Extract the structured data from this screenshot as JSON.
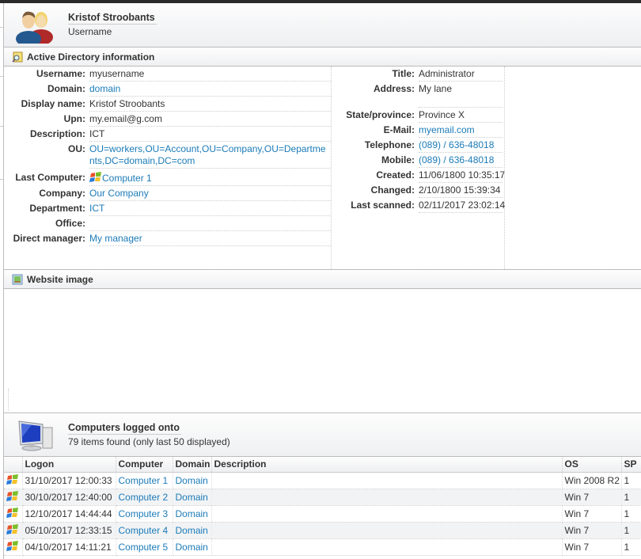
{
  "user": {
    "name": "Kristof Stroobants",
    "subtitle": "Username"
  },
  "sections": {
    "ad": {
      "title": "Active Directory information",
      "icon": "search-document-icon"
    },
    "website": {
      "title": "Website image",
      "icon": "image-icon"
    },
    "computers": {
      "title": "Computers logged onto",
      "subtitle": "79 items found (only last 50 displayed)",
      "icon": "computer-icon"
    }
  },
  "ad_left": [
    {
      "label": "Username:",
      "value": "myusername",
      "link": false
    },
    {
      "label": "Domain:",
      "value": "domain",
      "link": true
    },
    {
      "label": "Display name:",
      "value": "Kristof Stroobants",
      "link": false
    },
    {
      "label": "Upn:",
      "value": "my.email@g.com",
      "link": false
    },
    {
      "label": "Description:",
      "value": "ICT",
      "link": false
    },
    {
      "label": "OU:",
      "value": "OU=workers,OU=Account,OU=Company,OU=Departments,DC=domain,DC=com",
      "link": true
    },
    {
      "label": "Last Computer:",
      "value": "Computer 1",
      "link": true,
      "icon": "windows-icon"
    },
    {
      "label": "Company:",
      "value": "Our Company",
      "link": true
    },
    {
      "label": "Department:",
      "value": "ICT",
      "link": true
    },
    {
      "label": "Office:",
      "value": "",
      "link": false
    },
    {
      "label": "Direct manager:",
      "value": "My manager",
      "link": true
    }
  ],
  "ad_right": [
    {
      "label": "Title:",
      "value": "Administrator",
      "link": false
    },
    {
      "label": "Address:",
      "value": "My lane",
      "link": false,
      "tall": true
    },
    {
      "label": "State/province:",
      "value": "Province X",
      "link": false
    },
    {
      "label": "E-Mail:",
      "value": "myemail.com",
      "link": true
    },
    {
      "label": "Telephone:",
      "value": "(089) / 636-48018",
      "link": true
    },
    {
      "label": "Mobile:",
      "value": "(089) / 636-48018",
      "link": true
    },
    {
      "label": "Created:",
      "value": "11/06/1800 10:35:17",
      "link": false
    },
    {
      "label": "Changed:",
      "value": "2/10/1800 15:39:34",
      "link": false
    },
    {
      "label": "Last scanned:",
      "value": "02/11/2017 23:02:14",
      "link": false
    }
  ],
  "computers_table": {
    "columns": [
      "",
      "Logon",
      "Computer",
      "Domain",
      "Description",
      "OS",
      "SP"
    ],
    "rows": [
      {
        "logon": "31/10/2017 12:00:33",
        "computer": "Computer 1",
        "domain": "Domain",
        "description": "",
        "os": "Win 2008 R2",
        "sp": "1"
      },
      {
        "logon": "30/10/2017 12:40:00",
        "computer": "Computer 2",
        "domain": "Domain",
        "description": "",
        "os": "Win 7",
        "sp": "1"
      },
      {
        "logon": "12/10/2017 14:44:44",
        "computer": "Computer 3",
        "domain": "Domain",
        "description": "",
        "os": "Win 7",
        "sp": "1"
      },
      {
        "logon": "05/10/2017 12:33:15",
        "computer": "Computer 4",
        "domain": "Domain",
        "description": "",
        "os": "Win 7",
        "sp": "1"
      },
      {
        "logon": "04/10/2017 14:11:21",
        "computer": "Computer 5",
        "domain": "Domain",
        "description": "",
        "os": "Win 7",
        "sp": "1"
      }
    ]
  },
  "colors": {
    "link": "#1b7bb8",
    "text": "#333333",
    "topbar": "#2b2b2b"
  }
}
